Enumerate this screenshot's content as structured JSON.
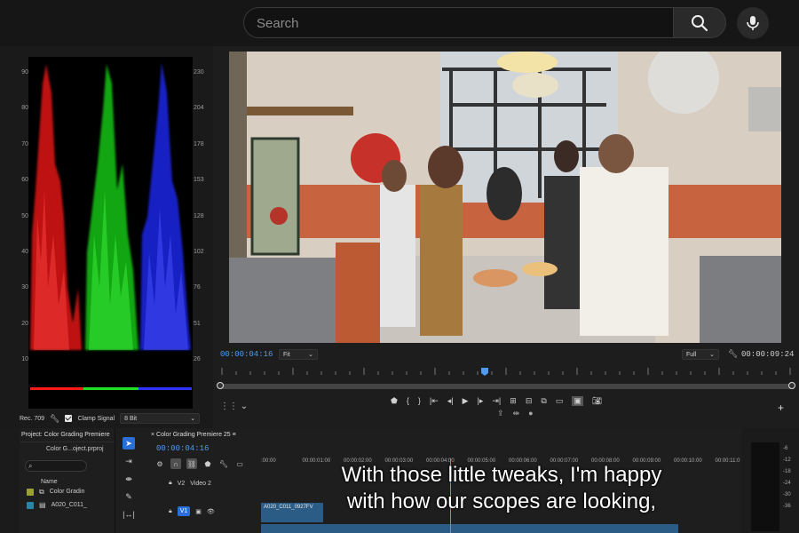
{
  "search": {
    "placeholder": "Search"
  },
  "scopes": {
    "left_scale": [
      "90",
      "80",
      "70",
      "60",
      "50",
      "40",
      "30",
      "20",
      "10"
    ],
    "right_scale": [
      "230",
      "204",
      "178",
      "153",
      "128",
      "102",
      "76",
      "51",
      "26"
    ],
    "standard": "Rec. 709",
    "clamp_label": "Clamp Signal",
    "bit_depth": "8 Bit",
    "colors": {
      "red": "#ff1a1a",
      "green": "#22e022",
      "blue": "#2a33ff"
    }
  },
  "monitor": {
    "timecode_current": "00:00:04:16",
    "fit": "Fit",
    "quality": "Full",
    "timecode_duration": "00:00:09:24"
  },
  "project": {
    "tab_title": "Project: Color Grading Premiere",
    "file_name": "Color G...oject.prproj",
    "name_header": "Name",
    "items": [
      {
        "label": "Color Gradin",
        "color": "#9aa035"
      },
      {
        "label": "A020_C011_",
        "color": "#2a86a6"
      }
    ]
  },
  "timeline": {
    "tab_title": "Color Grading Premiere 25",
    "timecode": "00:00:04:16",
    "ruler": [
      ":00:00",
      "00:00:01:00",
      "00:00:02:00",
      "00:00:03:00",
      "00:00:04:00",
      "00:00:05:00",
      "00:00:06:00",
      "00:00:07:00",
      "00:00:08:00",
      "00:00:09:00",
      "00:00:10:00",
      "00:00:11:0"
    ],
    "tracks": [
      {
        "label": "V2",
        "name": "Video 2"
      },
      {
        "label": "V1",
        "name": ""
      }
    ],
    "clip_label": "A020_C011_0927FV"
  },
  "meter": {
    "labels": [
      "-6",
      "-12",
      "-18",
      "-24",
      "-30",
      "-36"
    ]
  },
  "subtitle": {
    "line1": "With those little tweaks, I'm happy",
    "line2": "with how our scopes are looking,"
  }
}
